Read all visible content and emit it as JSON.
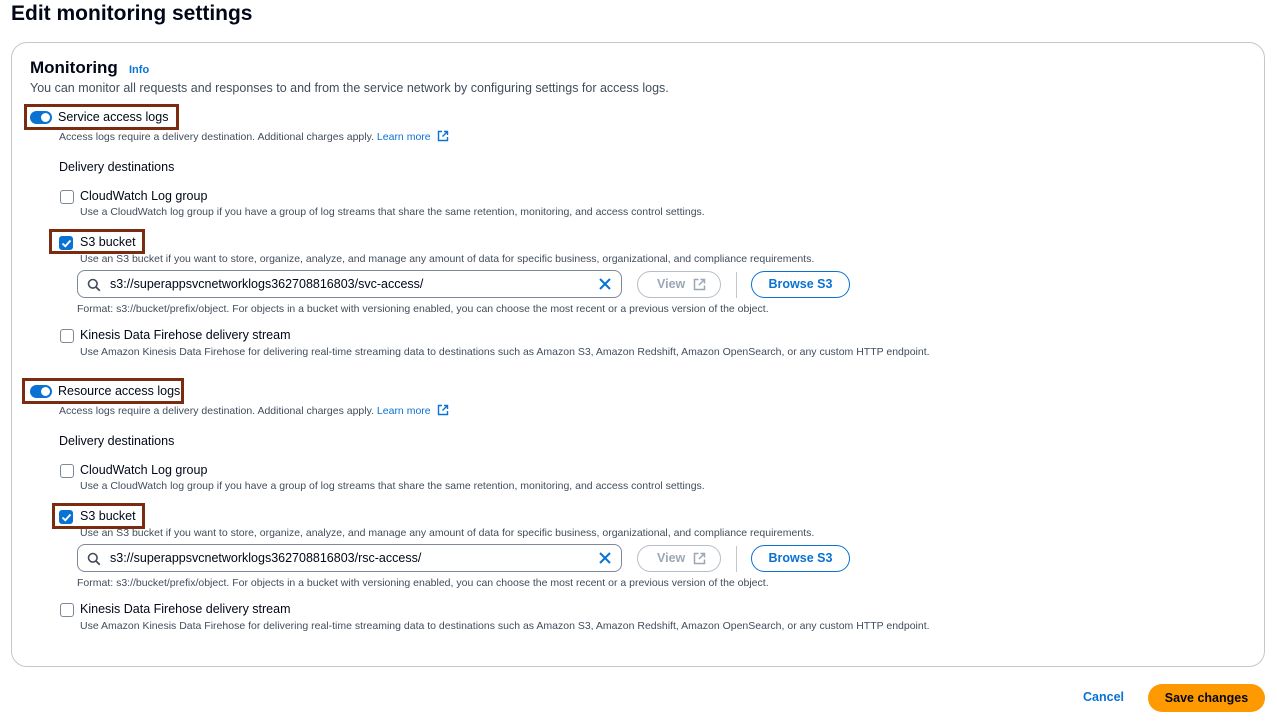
{
  "page": {
    "title": "Edit monitoring settings"
  },
  "monitoring": {
    "title": "Monitoring",
    "info_label": "Info",
    "description": "You can monitor all requests and responses to and from the service network by configuring settings for access logs."
  },
  "service_logs": {
    "toggle_label": "Service access logs",
    "toggle_on": true,
    "note": "Access logs require a delivery destination. Additional charges apply.",
    "learn_more": "Learn more",
    "delivery_heading": "Delivery destinations",
    "cloudwatch": {
      "label": "CloudWatch Log group",
      "checked": false,
      "desc": "Use a CloudWatch log group if you have a group of log streams that share the same retention, monitoring, and access control settings."
    },
    "s3": {
      "label": "S3 bucket",
      "checked": true,
      "desc": "Use an S3 bucket if you want to store, organize, analyze, and manage any amount of data for specific business, organizational, and compliance requirements.",
      "uri": "s3://superappsvcnetworklogs362708816803/svc-access/",
      "view_label": "View",
      "browse_label": "Browse S3",
      "format_hint": "Format: s3://bucket/prefix/object. For objects in a bucket with versioning enabled, you can choose the most recent or a previous version of the object."
    },
    "firehose": {
      "label": "Kinesis Data Firehose delivery stream",
      "checked": false,
      "desc": "Use Amazon Kinesis Data Firehose for delivering real-time streaming data to destinations such as Amazon S3, Amazon Redshift, Amazon OpenSearch, or any custom HTTP endpoint."
    }
  },
  "resource_logs": {
    "toggle_label": "Resource access logs",
    "toggle_on": true,
    "note": "Access logs require a delivery destination. Additional charges apply.",
    "learn_more": "Learn more",
    "delivery_heading": "Delivery destinations",
    "cloudwatch": {
      "label": "CloudWatch Log group",
      "checked": false,
      "desc": "Use a CloudWatch log group if you have a group of log streams that share the same retention, monitoring, and access control settings."
    },
    "s3": {
      "label": "S3 bucket",
      "checked": true,
      "desc": "Use an S3 bucket if you want to store, organize, analyze, and manage any amount of data for specific business, organizational, and compliance requirements.",
      "uri": "s3://superappsvcnetworklogs362708816803/rsc-access/",
      "view_label": "View",
      "browse_label": "Browse S3",
      "format_hint": "Format: s3://bucket/prefix/object. For objects in a bucket with versioning enabled, you can choose the most recent or a previous version of the object."
    },
    "firehose": {
      "label": "Kinesis Data Firehose delivery stream",
      "checked": false,
      "desc": "Use Amazon Kinesis Data Firehose for delivering real-time streaming data to destinations such as Amazon S3, Amazon Redshift, Amazon OpenSearch, or any custom HTTP endpoint."
    }
  },
  "footer": {
    "cancel_label": "Cancel",
    "save_label": "Save changes"
  },
  "icons": {
    "search": "search-icon",
    "clear": "close-icon",
    "external": "external-link-icon",
    "check": "check-icon"
  },
  "colors": {
    "accent": "#0972d3",
    "primary_button": "#ff9900",
    "highlight_box": "#7b2b10",
    "text": "#000716"
  }
}
